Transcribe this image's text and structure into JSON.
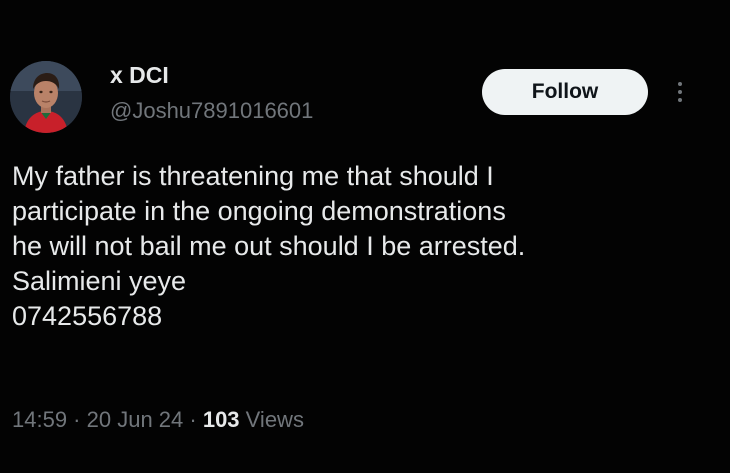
{
  "user": {
    "display_name": "x DCI",
    "handle": "@Joshu7891016601",
    "avatar_icon": "profile-photo"
  },
  "follow_button": {
    "label": "Follow"
  },
  "more_button": {
    "icon": "vertical-ellipsis-icon"
  },
  "tweet": {
    "lines": [
      "My father is threatening me that should I",
      "participate in the ongoing demonstrations",
      "he will not bail me out should I be arrested.",
      "Salimieni yeye",
      "0742556788"
    ]
  },
  "meta": {
    "time": "14:59",
    "separator": " · ",
    "date": "20 Jun 24",
    "views_count": "103",
    "views_label": " Views"
  },
  "colors": {
    "background": "#000000",
    "text_primary": "#e7e9ea",
    "text_secondary": "#71767b",
    "button_bg": "#eff3f4",
    "button_text": "#0f1419"
  }
}
